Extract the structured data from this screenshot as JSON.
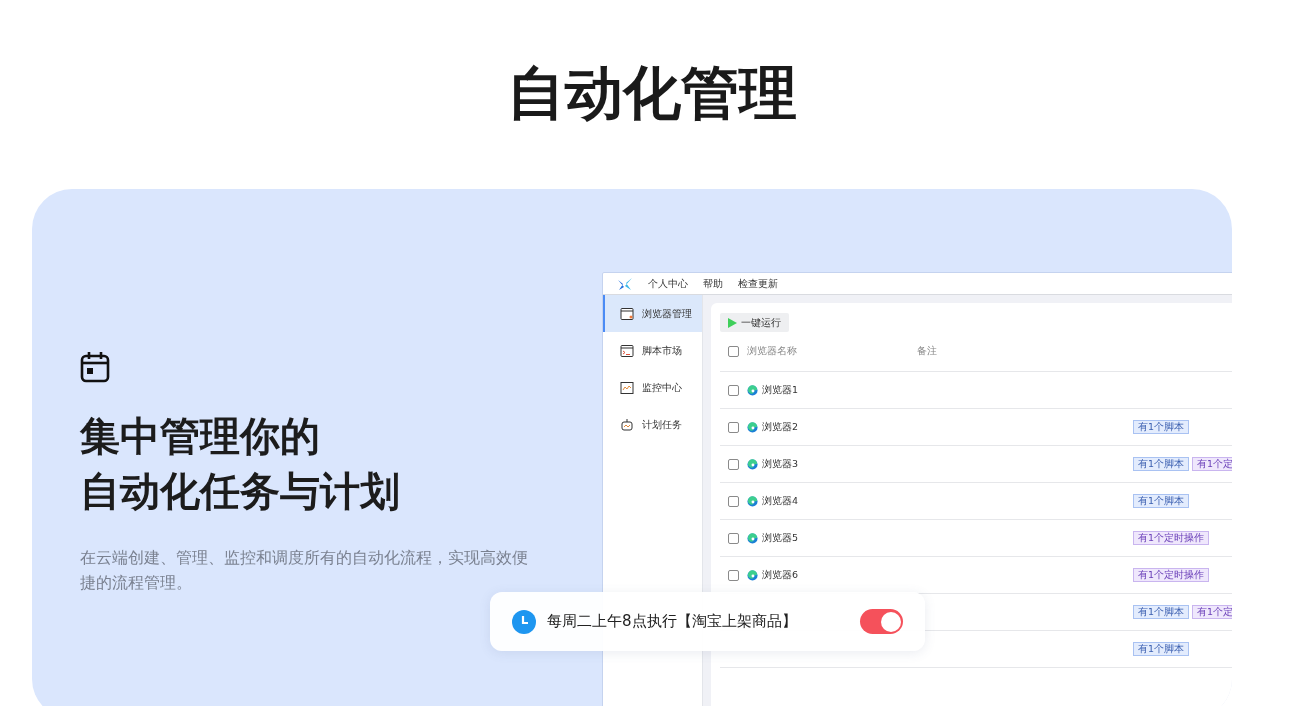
{
  "title": "自动化管理",
  "feature": {
    "heading_lines": [
      "集中管理你的",
      "自动化任务与计划"
    ],
    "description": "在云端创建、管理、监控和调度所有的自动化流程，实现高效便捷的流程管理。"
  },
  "app": {
    "menu": [
      "个人中心",
      "帮助",
      "检查更新"
    ],
    "sidebar": [
      {
        "label": "浏览器管理",
        "kind": "browser",
        "selected": true
      },
      {
        "label": "脚本市场",
        "kind": "terminal",
        "selected": false
      },
      {
        "label": "监控中心",
        "kind": "monitor",
        "selected": false
      },
      {
        "label": "计划任务",
        "kind": "robot",
        "selected": false
      }
    ],
    "run_button": "一键运行",
    "columns": [
      "浏览器名称",
      "备注"
    ],
    "header_checked": false,
    "rows": [
      {
        "name": "浏览器1",
        "checked": false,
        "tags": []
      },
      {
        "name": "浏览器2",
        "checked": false,
        "tags": [
          {
            "text": "有1个脚本",
            "kind": "script"
          }
        ]
      },
      {
        "name": "浏览器3",
        "checked": false,
        "tags": [
          {
            "text": "有1个脚本",
            "kind": "script"
          },
          {
            "text": "有1个定",
            "kind": "timer"
          }
        ]
      },
      {
        "name": "浏览器4",
        "checked": false,
        "tags": [
          {
            "text": "有1个脚本",
            "kind": "script"
          }
        ]
      },
      {
        "name": "浏览器5",
        "checked": false,
        "tags": [
          {
            "text": "有1个定时操作",
            "kind": "timer"
          }
        ]
      },
      {
        "name": "浏览器6",
        "checked": false,
        "tags": [
          {
            "text": "有1个定时操作",
            "kind": "timer"
          }
        ]
      },
      {
        "tags": [
          {
            "text": "有1个脚本",
            "kind": "script"
          },
          {
            "text": "有1个定",
            "kind": "timer"
          }
        ]
      },
      {
        "tags": [
          {
            "text": "有1个脚本",
            "kind": "script"
          }
        ]
      }
    ]
  },
  "toast": {
    "text": "每周二上午8点执行【淘宝上架商品】",
    "on": true
  }
}
